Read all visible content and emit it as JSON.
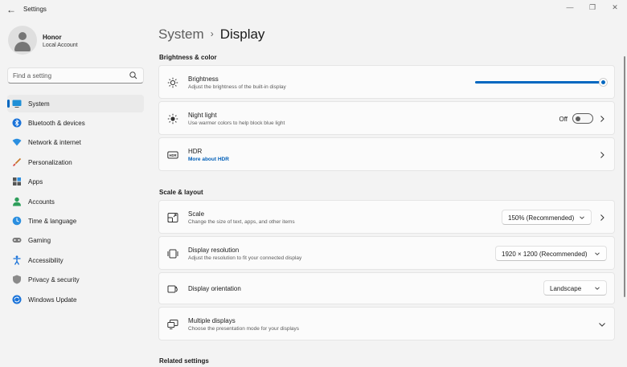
{
  "window": {
    "title": "Settings",
    "minimize": "—",
    "maximize": "❐",
    "close": "✕"
  },
  "profile": {
    "name": "Honor",
    "account_type": "Local Account"
  },
  "search": {
    "placeholder": "Find a setting"
  },
  "sidebar": {
    "items": [
      {
        "label": "System",
        "active": true
      },
      {
        "label": "Bluetooth & devices"
      },
      {
        "label": "Network & internet"
      },
      {
        "label": "Personalization"
      },
      {
        "label": "Apps"
      },
      {
        "label": "Accounts"
      },
      {
        "label": "Time & language"
      },
      {
        "label": "Gaming"
      },
      {
        "label": "Accessibility"
      },
      {
        "label": "Privacy & security"
      },
      {
        "label": "Windows Update"
      }
    ]
  },
  "breadcrumb": {
    "parent": "System",
    "separator": "›",
    "current": "Display"
  },
  "sections": {
    "brightness_color": "Brightness & color",
    "scale_layout": "Scale & layout",
    "related": "Related settings"
  },
  "cards": {
    "brightness": {
      "title": "Brightness",
      "subtitle": "Adjust the brightness of the built-in display",
      "value": 1.0
    },
    "night_light": {
      "title": "Night light",
      "subtitle": "Use warmer colors to help block blue light",
      "state": "Off"
    },
    "hdr": {
      "title": "HDR",
      "link": "More about HDR"
    },
    "scale": {
      "title": "Scale",
      "subtitle": "Change the size of text, apps, and other items",
      "value": "150% (Recommended)"
    },
    "resolution": {
      "title": "Display resolution",
      "subtitle": "Adjust the resolution to fit your connected display",
      "value": "1920 × 1200 (Recommended)"
    },
    "orientation": {
      "title": "Display orientation",
      "value": "Landscape"
    },
    "multiple": {
      "title": "Multiple displays",
      "subtitle": "Choose the presentation mode for your displays"
    }
  },
  "colors": {
    "accent": "#0067c0",
    "link": "#005fb8"
  }
}
